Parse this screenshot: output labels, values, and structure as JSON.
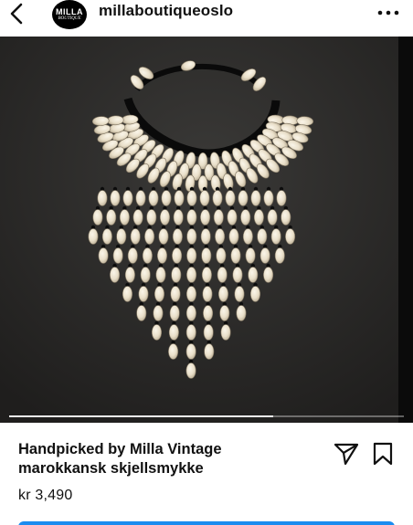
{
  "header": {
    "avatar_line1": "MILLA",
    "avatar_line2": "BOUTIQUE",
    "username": "millaboutiqueoslo"
  },
  "product": {
    "title_line1": "Handpicked by Milla Vintage",
    "title_line2": "marokkansk skjellsmykke",
    "price": "kr 3,490"
  },
  "media": {
    "progress": 0.67
  },
  "icons": {
    "back": "chevron-left-icon",
    "more": "more-horizontal-icon",
    "share": "send-icon",
    "save": "bookmark-icon"
  },
  "colors": {
    "background": "#ffffff",
    "text": "#111111",
    "accent": "#1a8cf0",
    "media_bg": "#2c2b2a"
  }
}
